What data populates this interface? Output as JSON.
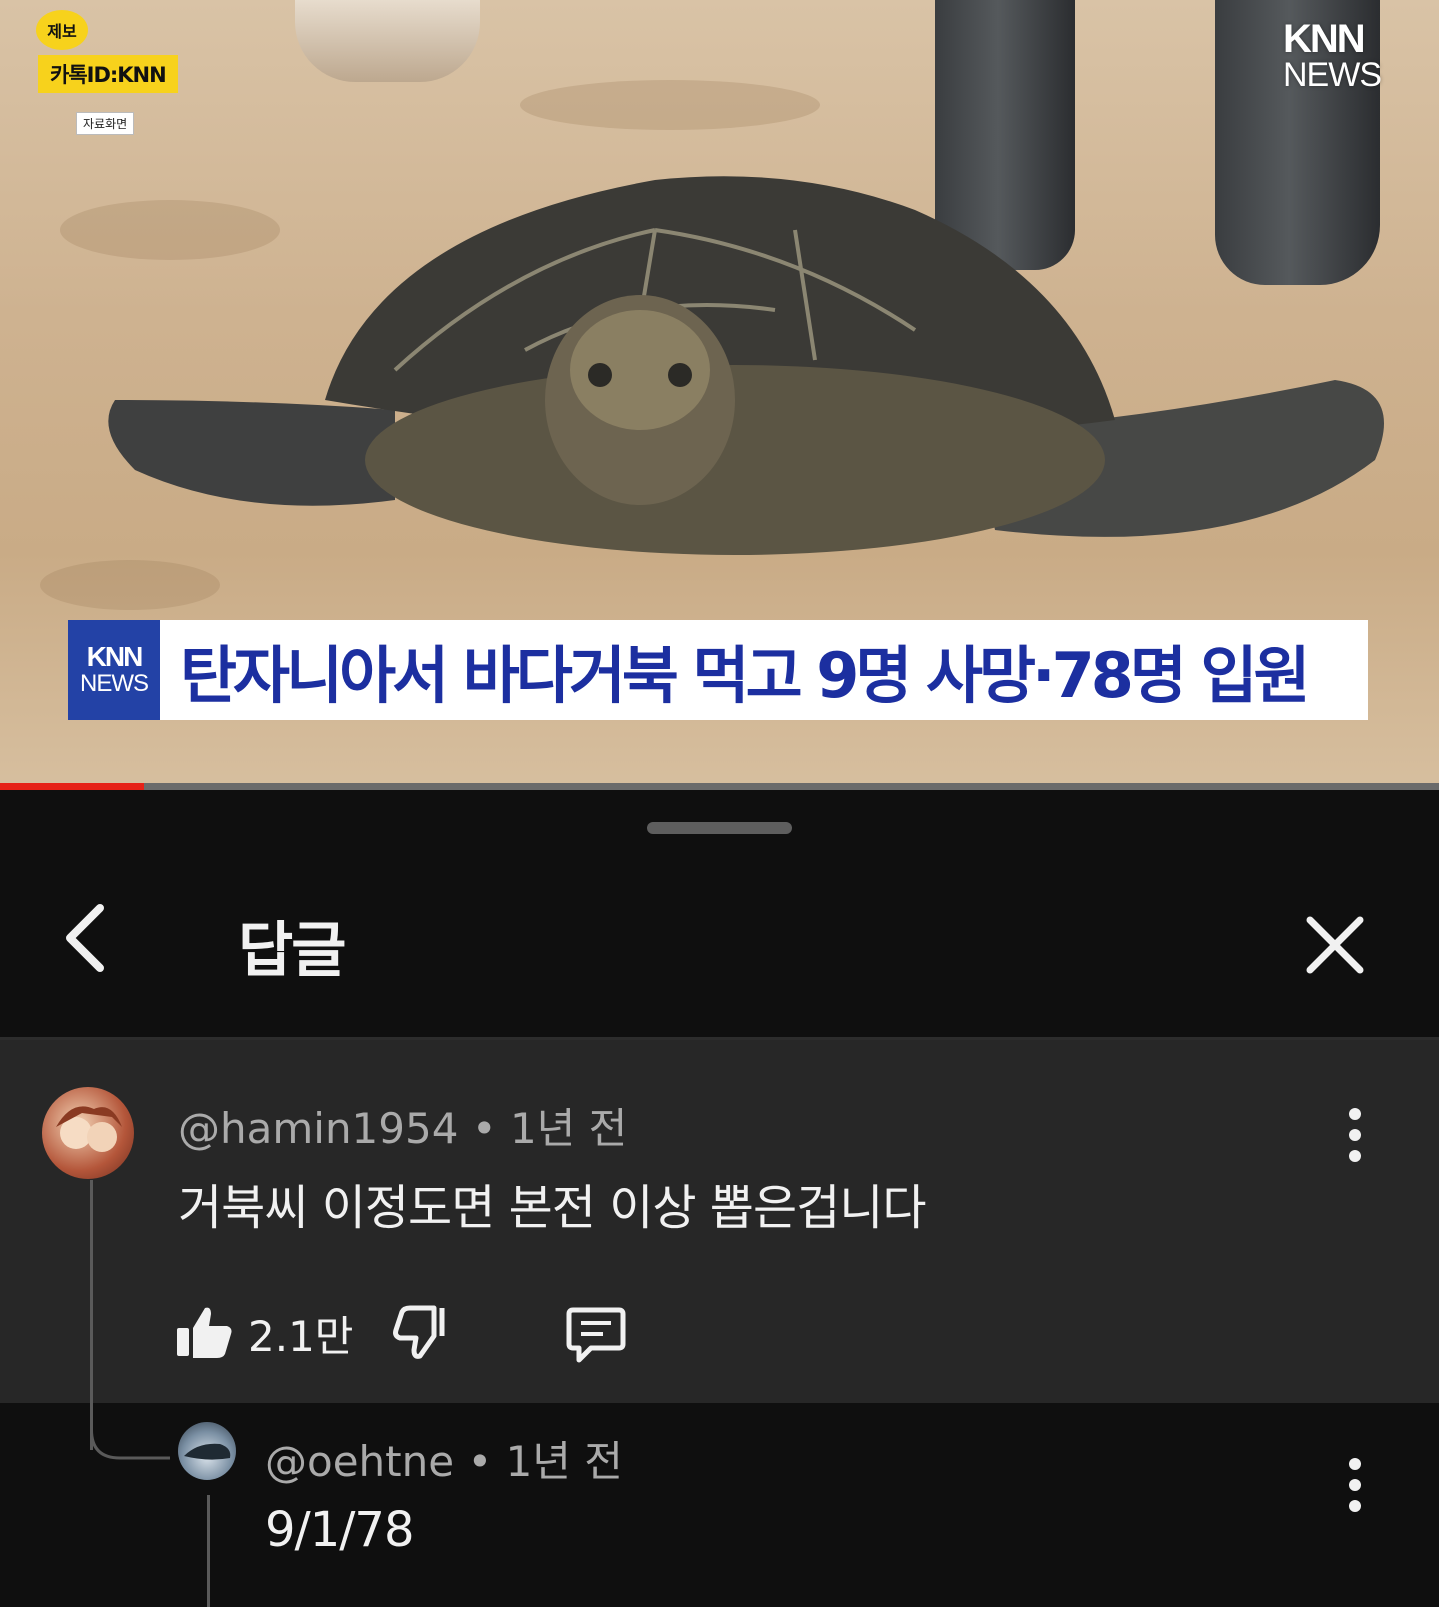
{
  "video": {
    "tip_badge": "제보",
    "kakao_id": "카톡ID:KNN",
    "archive_label": "자료화면",
    "brand_line1": "KNN",
    "brand_line2": "NEWS",
    "headline_logo_line1": "KNN",
    "headline_logo_line2": "NEWS",
    "headline": "탄자니아서 바다거북 먹고 9명 사망·78명 입원",
    "progress": 0.1
  },
  "sheet": {
    "title": "답글"
  },
  "comment": {
    "username": "@hamin1954",
    "time": "1년 전",
    "text": "거북씨 이정도면 본전 이상 뽑은겁니다",
    "likes": "2.1만"
  },
  "reply": {
    "username": "@oehtne",
    "time": "1년 전",
    "text": "9/1/78"
  },
  "colors": {
    "sheet_bg": "#0f0f0f",
    "highlight_bg": "#272727",
    "progress": "#e62117",
    "headline_blue": "#1c2fa0"
  }
}
